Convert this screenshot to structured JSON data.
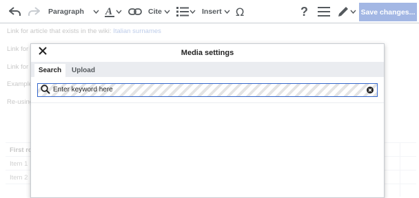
{
  "toolbar": {
    "paragraph_label": "Paragraph",
    "cite_label": "Cite",
    "insert_label": "Insert",
    "save_label": "Save changes...",
    "accent": "#a3b7e4"
  },
  "article": {
    "line1_text": "Link for article that exists in the wiki:",
    "line1_link": "Italian surnames",
    "line2_text": "Link for a",
    "line3_text": "Link for a",
    "line4_text": "Example",
    "line5_text": "Re-using"
  },
  "table": {
    "header": "First ro",
    "rows": [
      "Item 1",
      "Item 2"
    ]
  },
  "dialog": {
    "title": "Media settings",
    "tabs": [
      {
        "label": "Search",
        "active": true
      },
      {
        "label": "Upload",
        "active": false
      }
    ],
    "search": {
      "placeholder": "Enter keyword here",
      "value": "Enter keyword here"
    }
  },
  "icons": [
    "undo-icon",
    "redo-icon",
    "text-style-icon",
    "link-icon",
    "list-icon",
    "omega-icon",
    "help-icon",
    "menu-icon",
    "pencil-icon",
    "close-icon",
    "search-icon",
    "clear-icon",
    "chevron-down-icon"
  ]
}
